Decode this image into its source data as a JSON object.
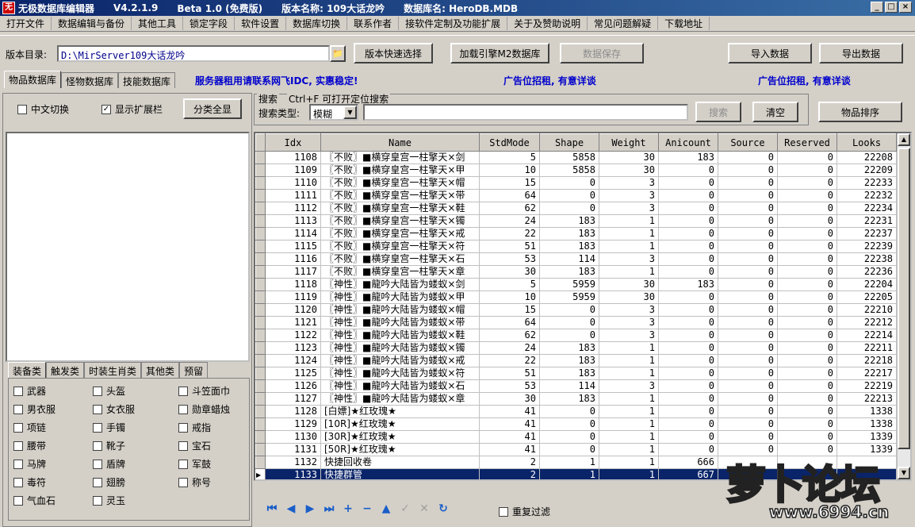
{
  "window": {
    "app_title": "无极数据库编辑器",
    "version": "V4.2.1.9",
    "beta": "Beta 1.0 (免费版)",
    "version_name": "版本名称: 109大话龙吟",
    "db_name": "数据库名: HeroDB.MDB"
  },
  "menu": [
    "打开文件",
    "数据编辑与备份",
    "其他工具",
    "锁定字段",
    "软件设置",
    "数据库切换",
    "联系作者",
    "接软件定制及功能扩展",
    "关于及赞助说明",
    "常见问题解疑",
    "下载地址"
  ],
  "toolbar": {
    "dir_label": "版本目录:",
    "dir_value": "D:\\MirServer109大话龙吟",
    "quick_select": "版本快速选择",
    "load_engine": "加载引擎M2数据库",
    "save_data": "数据保存",
    "import": "导入数据",
    "export": "导出数据"
  },
  "tabs": [
    "物品数据库",
    "怪物数据库",
    "技能数据库"
  ],
  "ads": [
    "服务器租用请联系网飞IDC, 实惠稳定!",
    "广告位招租, 有意详谈",
    "广告位招租, 有意详谈"
  ],
  "left": {
    "chinese_switch": "中文切换",
    "show_ext": "显示扩展栏",
    "show_all": "分类全显",
    "category_tabs": [
      "装备类",
      "触发类",
      "时装生肖类",
      "其他类",
      "预留"
    ],
    "categories": [
      "武器",
      "头盔",
      "斗笠面巾",
      "男衣服",
      "女衣服",
      "勋章蜡烛",
      "项链",
      "手镯",
      "戒指",
      "腰带",
      "靴子",
      "宝石",
      "马牌",
      "盾牌",
      "军鼓",
      "毒符",
      "翅膀",
      "称号",
      "气血石",
      "灵玉"
    ]
  },
  "search": {
    "group_label": "搜索",
    "hint": "Ctrl+F 可打开定位搜索",
    "type_label": "搜索类型:",
    "type_value": "模糊",
    "search_btn": "搜索",
    "clear_btn": "清空",
    "sort_btn": "物品排序"
  },
  "grid": {
    "columns": [
      "Idx",
      "Name",
      "StdMode",
      "Shape",
      "Weight",
      "Anicount",
      "Source",
      "Reserved",
      "Looks"
    ],
    "rows": [
      [
        "1108",
        "〖不败〗■横穿皇宫一柱擎天×剑",
        "5",
        "5858",
        "30",
        "183",
        "0",
        "0",
        "22208"
      ],
      [
        "1109",
        "〖不败〗■横穿皇宫一柱擎天×甲",
        "10",
        "5858",
        "30",
        "0",
        "0",
        "0",
        "22209"
      ],
      [
        "1110",
        "〖不败〗■横穿皇宫一柱擎天×帽",
        "15",
        "0",
        "3",
        "0",
        "0",
        "0",
        "22233"
      ],
      [
        "1111",
        "〖不败〗■横穿皇宫一柱擎天×带",
        "64",
        "0",
        "3",
        "0",
        "0",
        "0",
        "22232"
      ],
      [
        "1112",
        "〖不败〗■横穿皇宫一柱擎天×鞋",
        "62",
        "0",
        "3",
        "0",
        "0",
        "0",
        "22234"
      ],
      [
        "1113",
        "〖不败〗■横穿皇宫一柱擎天×镯",
        "24",
        "183",
        "1",
        "0",
        "0",
        "0",
        "22231"
      ],
      [
        "1114",
        "〖不败〗■横穿皇宫一柱擎天×戒",
        "22",
        "183",
        "1",
        "0",
        "0",
        "0",
        "22237"
      ],
      [
        "1115",
        "〖不败〗■横穿皇宫一柱擎天×符",
        "51",
        "183",
        "1",
        "0",
        "0",
        "0",
        "22239"
      ],
      [
        "1116",
        "〖不败〗■横穿皇宫一柱擎天×石",
        "53",
        "114",
        "3",
        "0",
        "0",
        "0",
        "22238"
      ],
      [
        "1117",
        "〖不败〗■横穿皇宫一柱擎天×章",
        "30",
        "183",
        "1",
        "0",
        "0",
        "0",
        "22236"
      ],
      [
        "1118",
        "〖神性〗■龍吟大陆皆为蝼蚁×剑",
        "5",
        "5959",
        "30",
        "183",
        "0",
        "0",
        "22204"
      ],
      [
        "1119",
        "〖神性〗■龍吟大陆皆为蝼蚁×甲",
        "10",
        "5959",
        "30",
        "0",
        "0",
        "0",
        "22205"
      ],
      [
        "1120",
        "〖神性〗■龍吟大陆皆为蝼蚁×帽",
        "15",
        "0",
        "3",
        "0",
        "0",
        "0",
        "22210"
      ],
      [
        "1121",
        "〖神性〗■龍吟大陆皆为蝼蚁×带",
        "64",
        "0",
        "3",
        "0",
        "0",
        "0",
        "22212"
      ],
      [
        "1122",
        "〖神性〗■龍吟大陆皆为蝼蚁×鞋",
        "62",
        "0",
        "3",
        "0",
        "0",
        "0",
        "22214"
      ],
      [
        "1123",
        "〖神性〗■龍吟大陆皆为蝼蚁×镯",
        "24",
        "183",
        "1",
        "0",
        "0",
        "0",
        "22211"
      ],
      [
        "1124",
        "〖神性〗■龍吟大陆皆为蝼蚁×戒",
        "22",
        "183",
        "1",
        "0",
        "0",
        "0",
        "22218"
      ],
      [
        "1125",
        "〖神性〗■龍吟大陆皆为蝼蚁×符",
        "51",
        "183",
        "1",
        "0",
        "0",
        "0",
        "22217"
      ],
      [
        "1126",
        "〖神性〗■龍吟大陆皆为蝼蚁×石",
        "53",
        "114",
        "3",
        "0",
        "0",
        "0",
        "22219"
      ],
      [
        "1127",
        "〖神性〗■龍吟大陆皆为蝼蚁×章",
        "30",
        "183",
        "1",
        "0",
        "0",
        "0",
        "22213"
      ],
      [
        "1128",
        "[白嫖]★红玫瑰★",
        "41",
        "0",
        "1",
        "0",
        "0",
        "0",
        "1338"
      ],
      [
        "1129",
        "[10R]★红玫瑰★",
        "41",
        "0",
        "1",
        "0",
        "0",
        "0",
        "1338"
      ],
      [
        "1130",
        "[30R]★红玫瑰★",
        "41",
        "0",
        "1",
        "0",
        "0",
        "0",
        "1339"
      ],
      [
        "1131",
        "[50R]★红玫瑰★",
        "41",
        "0",
        "1",
        "0",
        "0",
        "0",
        "1339"
      ],
      [
        "1132",
        "快捷回收卷",
        "2",
        "1",
        "1",
        "666",
        "",
        "",
        ""
      ],
      [
        "1133",
        "快捷群管",
        "2",
        "1",
        "1",
        "667",
        "",
        "",
        ""
      ]
    ],
    "selected_index": 25
  },
  "nav": {
    "icons": [
      "first-icon",
      "prior-icon",
      "next-icon",
      "last-icon",
      "insert-icon",
      "delete-icon",
      "edit-icon",
      "post-icon",
      "cancel-icon",
      "refresh-icon"
    ],
    "dup_filter": "重复过滤"
  },
  "watermark": {
    "name": "萝卜论坛",
    "url": "www.6994.cn"
  },
  "colors": {
    "title_bar": "#0a246a",
    "ad_text": "#0000cc",
    "selection": "#0a246a",
    "nav_icon": "#1a5ec8"
  }
}
